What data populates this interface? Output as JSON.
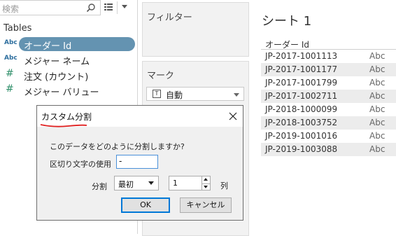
{
  "data_pane": {
    "search": {
      "placeholder": "検索"
    },
    "tables_heading": "Tables",
    "fields": [
      {
        "type_badge": "Abc",
        "label": "オーダー Id",
        "selected": true
      },
      {
        "type_badge": "Abc",
        "label": "メジャー ネーム",
        "selected": false
      },
      {
        "type_badge": "#",
        "label": "注文 (カウント)",
        "selected": false
      },
      {
        "type_badge": "#",
        "label": "メジャー バリュー",
        "selected": false
      }
    ]
  },
  "filters_card": {
    "title": "フィルター"
  },
  "marks_card": {
    "title": "マーク",
    "mark_type": "自動",
    "mark_type_icon_glyph": "T"
  },
  "sheet": {
    "title": "シート 1",
    "column_header": "オーダー Id",
    "rows": [
      {
        "value": "JP-2017-1001113",
        "abc": "Abc"
      },
      {
        "value": "JP-2017-1001177",
        "abc": "Abc"
      },
      {
        "value": "JP-2017-1001799",
        "abc": "Abc"
      },
      {
        "value": "JP-2017-1002711",
        "abc": "Abc"
      },
      {
        "value": "JP-2018-1000099",
        "abc": "Abc"
      },
      {
        "value": "JP-2018-1003752",
        "abc": "Abc"
      },
      {
        "value": "JP-2019-1001016",
        "abc": "Abc"
      },
      {
        "value": "JP-2019-1003088",
        "abc": "Abc"
      }
    ]
  },
  "dialog": {
    "title": "カスタム分割",
    "question": "このデータをどのように分割しますか?",
    "delimiter_label": "区切り文字の使用",
    "delimiter_value": "-",
    "split_label": "分割",
    "split_option": "最初",
    "count_value": "1",
    "count_unit": "列",
    "ok_label": "OK",
    "cancel_label": "キャンセル"
  },
  "colors": {
    "selected_pill": "#6493b1",
    "annotation_underline": "#e02020",
    "default_button_border": "#0078d7"
  }
}
